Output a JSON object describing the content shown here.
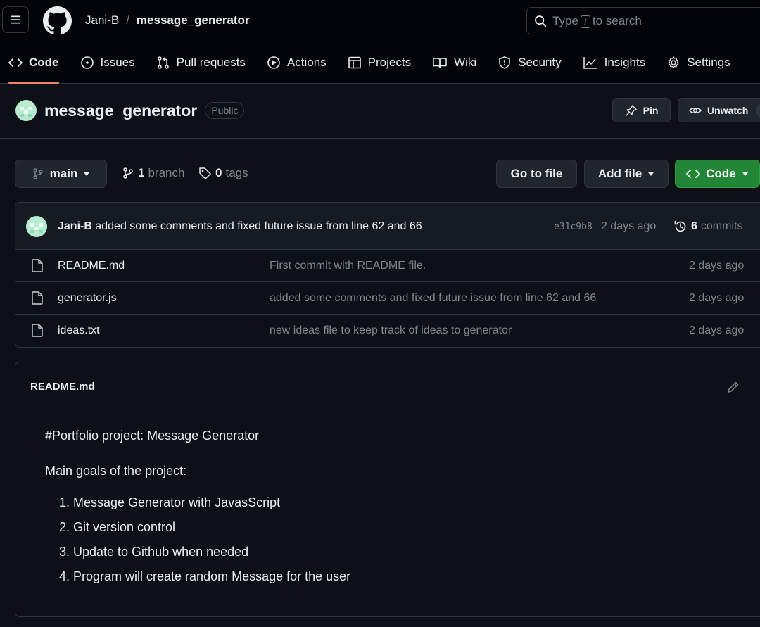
{
  "header": {
    "owner": "Jani-B",
    "separator": "/",
    "repo": "message_generator",
    "search": {
      "prefix": "Type",
      "key": "/",
      "suffix": "to search"
    }
  },
  "tabs": [
    {
      "label": "Code",
      "icon": "code-icon",
      "active": true
    },
    {
      "label": "Issues",
      "icon": "issue-opened-icon"
    },
    {
      "label": "Pull requests",
      "icon": "git-pull-request-icon"
    },
    {
      "label": "Actions",
      "icon": "play-icon"
    },
    {
      "label": "Projects",
      "icon": "table-icon"
    },
    {
      "label": "Wiki",
      "icon": "book-icon"
    },
    {
      "label": "Security",
      "icon": "shield-icon"
    },
    {
      "label": "Insights",
      "icon": "graph-icon"
    },
    {
      "label": "Settings",
      "icon": "gear-icon"
    }
  ],
  "repo": {
    "name": "message_generator",
    "visibility": "Public",
    "pin_label": "Pin",
    "watch_label": "Unwatch"
  },
  "branch_bar": {
    "branch": "main",
    "branch_count": "1",
    "branch_word": "branch",
    "tag_count": "0",
    "tag_word": "tags",
    "go_to_file": "Go to file",
    "add_file": "Add file",
    "code": "Code"
  },
  "latest_commit": {
    "author": "Jani-B",
    "message": "added some comments and fixed future issue from line 62 and 66",
    "sha": "e31c9b8",
    "ago": "2 days ago",
    "commit_count": "6",
    "commit_word": "commits"
  },
  "files": [
    {
      "name": "README.md",
      "message": "First commit with README file.",
      "date": "2 days ago"
    },
    {
      "name": "generator.js",
      "message": "added some comments and fixed future issue from line 62 and 66",
      "date": "2 days ago"
    },
    {
      "name": "ideas.txt",
      "message": "new ideas file to keep track of ideas to generator",
      "date": "2 days ago"
    }
  ],
  "readme": {
    "title": "README.md",
    "heading": "#Portfolio project: Message Generator",
    "intro": "Main goals of the project:",
    "goals": [
      "Message Generator with JavasScript",
      "Git version control",
      "Update to Github when needed",
      "Program will create random Message for the user"
    ]
  },
  "colors": {
    "background": "#0d1117",
    "accent_underline": "#f78166",
    "code_button": "#238636",
    "muted_text": "#7d8590",
    "border": "#30363d"
  }
}
